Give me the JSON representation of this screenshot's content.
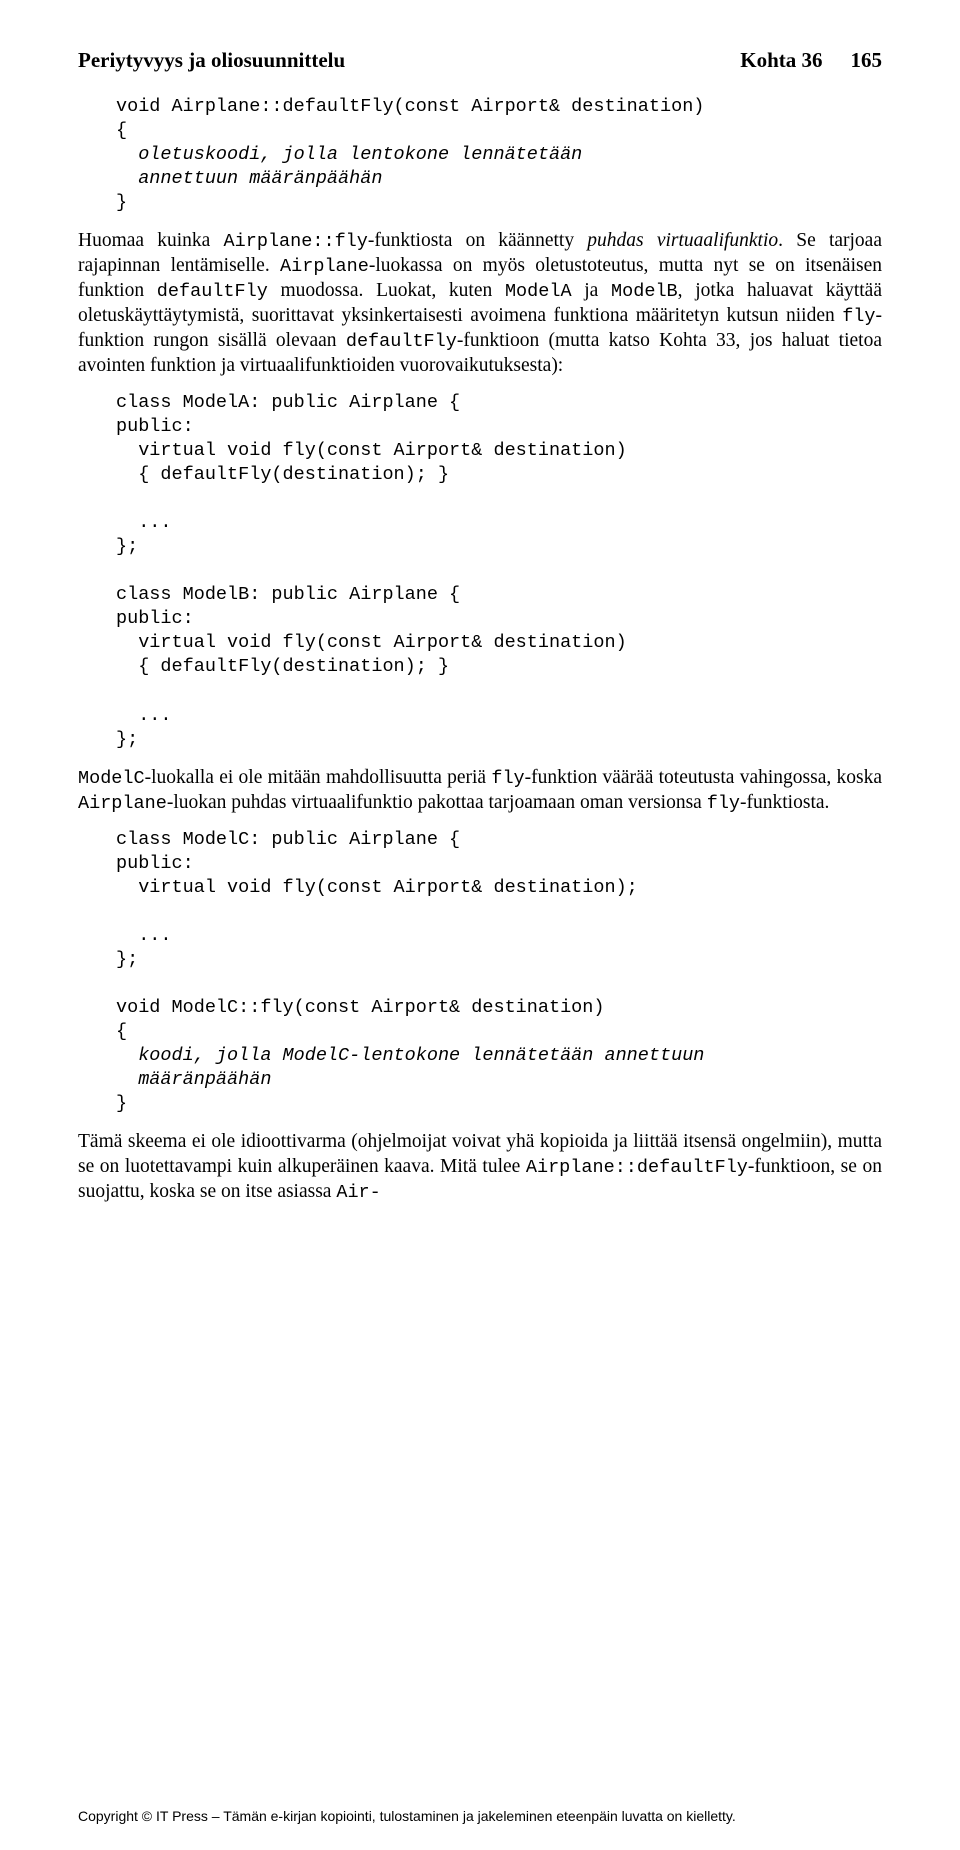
{
  "header": {
    "left": "Periytyvyys ja oliosuunnittelu",
    "kohta": "Kohta 36",
    "page": "165"
  },
  "code1": {
    "l1": "void Airplane::defaultFly(const Airport& destination)",
    "l2": "{",
    "l3": "  oletuskoodi, jolla lentokone lennätetään",
    "l4": "  annettuun määränpäähän",
    "l5": "}"
  },
  "para1": {
    "a": "Huomaa kuinka ",
    "b": "Airplane::fly",
    "c": "-funktiosta on käännetty ",
    "d": "puhdas virtuaalifunktio",
    "e": ". Se tarjoaa rajapinnan lentämiselle. ",
    "f": "Airplane",
    "g": "-luokassa on myös oletustoteutus, mutta nyt se on itsenäisen funktion ",
    "h": "defaultFly",
    "i": " muodossa. Luokat, kuten ",
    "j": "ModelA",
    "k": " ja ",
    "l": "ModelB",
    "m": ", jotka haluavat käyttää oletuskäyttäytymistä, suorittavat yksinkertaisesti avoimena funktiona määritetyn kutsun niiden ",
    "n": "fly",
    "o": "-funktion rungon sisällä olevaan ",
    "p": "defaultFly",
    "q": "-funktioon (mutta katso Kohta 33, jos haluat tietoa avointen funktion ja virtuaalifunktioiden vuorovaikutuksesta):"
  },
  "code2": {
    "l1": "class ModelA: public Airplane {",
    "l2": "public:",
    "l3": "  virtual void fly(const Airport& destination)",
    "l4": "  { defaultFly(destination); }",
    "l5": "  ...",
    "l6": "};",
    "l7": "class ModelB: public Airplane {",
    "l8": "public:",
    "l9": "  virtual void fly(const Airport& destination)",
    "l10": "  { defaultFly(destination); }",
    "l11": "  ...",
    "l12": "};"
  },
  "para2": {
    "a": "ModelC",
    "b": "-luokalla ei ole mitään mahdollisuutta periä ",
    "c": "fly",
    "d": "-funktion väärää toteutusta vahingossa, koska ",
    "e": "Airplane",
    "f": "-luokan puhdas virtuaalifunktio pakottaa tarjoamaan oman versionsa ",
    "g": "fly",
    "h": "-funktiosta."
  },
  "code3": {
    "l1": "class ModelC: public Airplane {",
    "l2": "public:",
    "l3": "  virtual void fly(const Airport& destination);",
    "l4": "  ...",
    "l5": "};",
    "l6": "void ModelC::fly(const Airport& destination)",
    "l7": "{",
    "l8": "  koodi, jolla ModelC-lentokone lennätetään annettuun",
    "l9": "  määränpäähän",
    "l10": "}"
  },
  "para3": {
    "a": "Tämä skeema ei ole idioottivarma (ohjelmoijat voivat yhä kopioida ja liittää itsensä ongelmiin), mutta se on luotettavampi kuin alkuperäinen kaava. Mitä tulee ",
    "b": "Airplane::defaultFly",
    "c": "-funktioon, se on suojattu, koska se on itse asiassa ",
    "d": "Air-"
  },
  "footer": "Copyright © IT Press – Tämän e-kirjan kopiointi, tulostaminen ja jakeleminen eteenpäin luvatta on kielletty."
}
